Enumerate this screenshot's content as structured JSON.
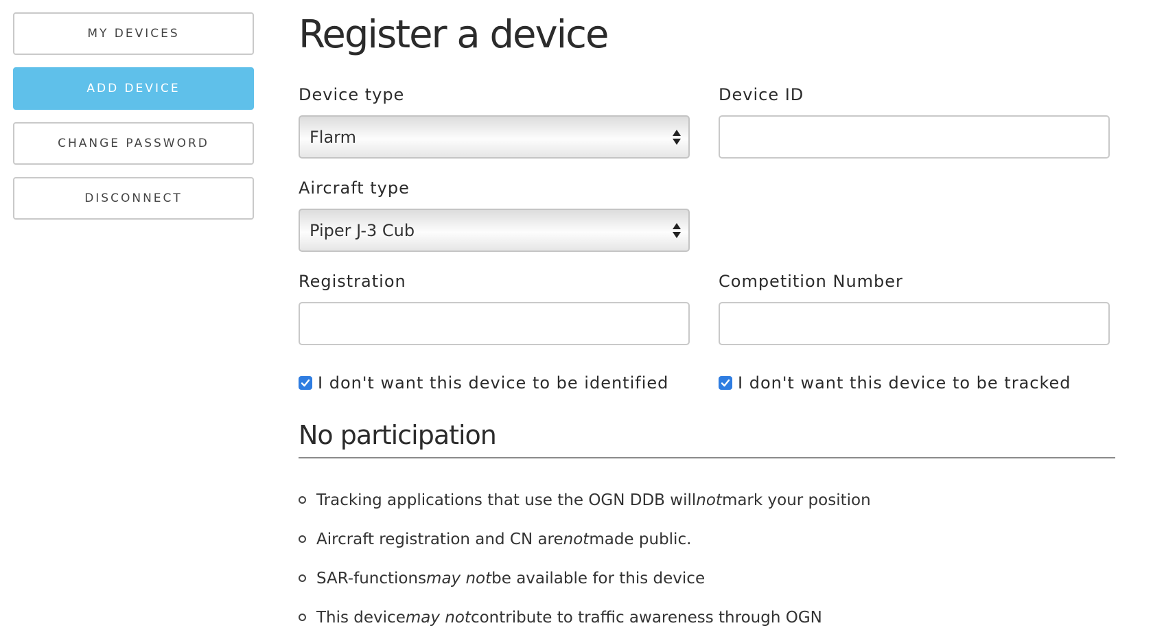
{
  "sidebar": {
    "items": [
      {
        "label": "MY DEVICES",
        "active": false
      },
      {
        "label": "ADD DEVICE",
        "active": true
      },
      {
        "label": "CHANGE PASSWORD",
        "active": false
      },
      {
        "label": "DISCONNECT",
        "active": false
      }
    ]
  },
  "page": {
    "title": "Register a device"
  },
  "form": {
    "device_type": {
      "label": "Device type",
      "value": "Flarm"
    },
    "device_id": {
      "label": "Device ID",
      "value": "",
      "placeholder": ""
    },
    "aircraft_type": {
      "label": "Aircraft type",
      "value": "Piper J-3 Cub"
    },
    "registration": {
      "label": "Registration",
      "value": "",
      "placeholder": ""
    },
    "competition_number": {
      "label": "Competition Number",
      "value": "",
      "placeholder": ""
    },
    "no_identify": {
      "label": "I don't want this device to be identified",
      "checked": true
    },
    "no_track": {
      "label": "I don't want this device to be tracked",
      "checked": true
    }
  },
  "participation": {
    "title": "No participation",
    "bullets": [
      {
        "before": "Tracking applications that use the OGN DDB will ",
        "emph": "not",
        "after": " mark your position"
      },
      {
        "before": "Aircraft registration and CN are ",
        "emph": "not",
        "after": " made public."
      },
      {
        "before": "SAR-functions ",
        "emph": "may not",
        "after": " be available for this device"
      },
      {
        "before": "This device ",
        "emph": "may not",
        "after": " contribute to traffic awareness through OGN"
      }
    ]
  },
  "colors": {
    "accent": "#5fc0ea",
    "checkbox": "#2f7de1"
  },
  "icons": {
    "select_arrows": "up-down-arrows-icon",
    "checkbox_check": "checkmark-icon",
    "bullet": "hollow-circle-bullet-icon"
  }
}
